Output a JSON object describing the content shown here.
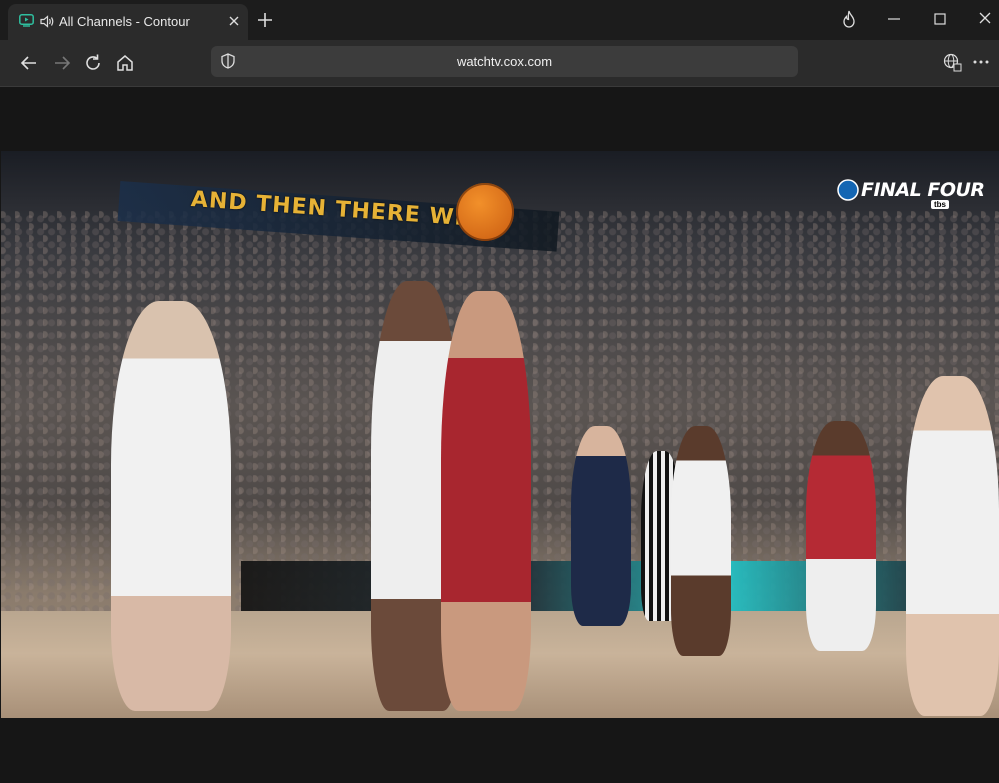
{
  "browser": {
    "tab": {
      "title": "All Channels - Contour",
      "favicon": "tv-play-icon",
      "audio": "speaker-icon"
    },
    "address": {
      "url": "watchtv.cox.com"
    },
    "colors": {
      "titlebar": "#1c1c1c",
      "toolbar": "#2b2b2b",
      "omnibox": "#3c3c3c",
      "favicon": "#2fbf9f"
    }
  },
  "video": {
    "banner_text": "AND THEN THERE WE",
    "score_bug": {
      "title": "FINAL FOUR",
      "network": "tbs"
    }
  }
}
